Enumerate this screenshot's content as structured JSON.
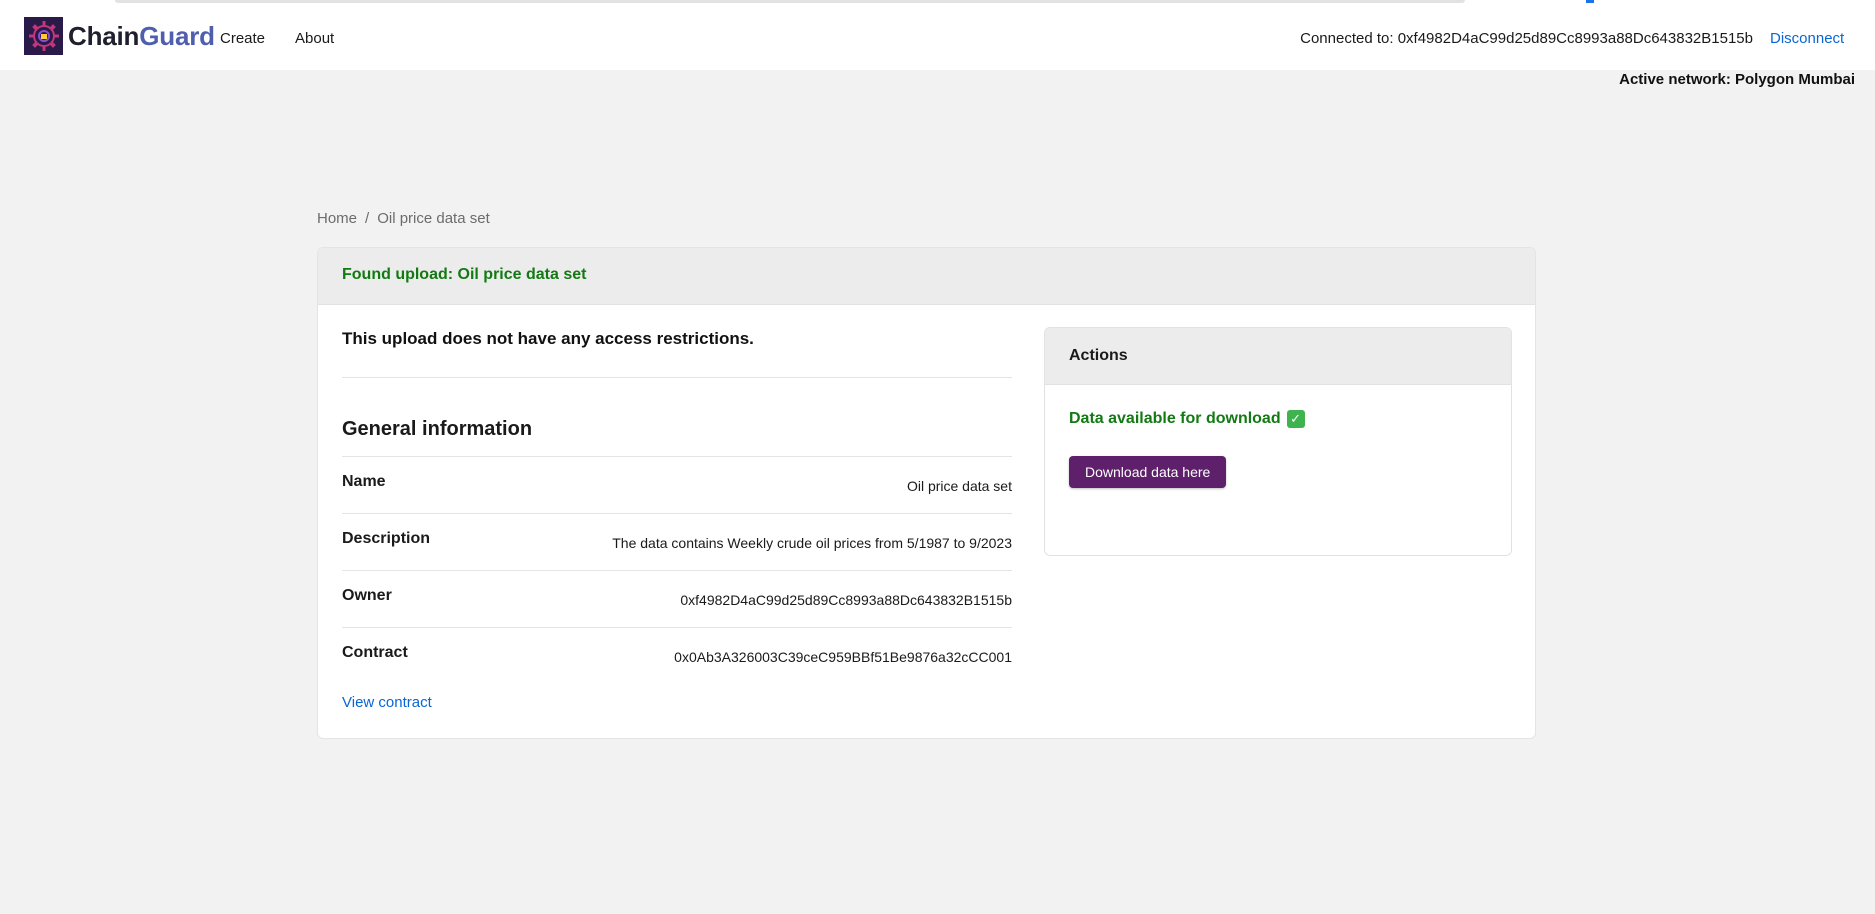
{
  "header": {
    "brand_part1": "Chain",
    "brand_part2": "Guard",
    "nav": [
      {
        "label": "Create"
      },
      {
        "label": "About"
      }
    ],
    "connected_text": "Connected to: 0xf4982D4aC99d25d89Cc8993a88Dc643832B1515b",
    "disconnect_label": "Disconnect",
    "active_network": "Active network: Polygon Mumbai"
  },
  "breadcrumb": {
    "home": "Home",
    "separator": "/",
    "current": "Oil price data set"
  },
  "upload": {
    "found_title": "Found upload: Oil price data set",
    "restriction_text": "This upload does not have any access restrictions.",
    "general_heading": "General information",
    "fields": [
      {
        "label": "Name",
        "value": "Oil price data set"
      },
      {
        "label": "Description",
        "value": "The data contains Weekly crude oil prices from 5/1987 to 9/2023"
      },
      {
        "label": "Owner",
        "value": "0xf4982D4aC99d25d89Cc8993a88Dc643832B1515b"
      },
      {
        "label": "Contract",
        "value": "0x0Ab3A326003C39ceC959BBf51Be9876a32cCC001"
      }
    ],
    "view_contract_label": "View contract"
  },
  "actions": {
    "title": "Actions",
    "status_text": "Data available for download",
    "status_icon": "check-box-icon",
    "download_label": "Download data here"
  },
  "colors": {
    "success_green": "#137a13",
    "link_blue": "#0a66d6",
    "button_purple": "#5e1f6b",
    "brand_blue": "#4f5fae"
  }
}
